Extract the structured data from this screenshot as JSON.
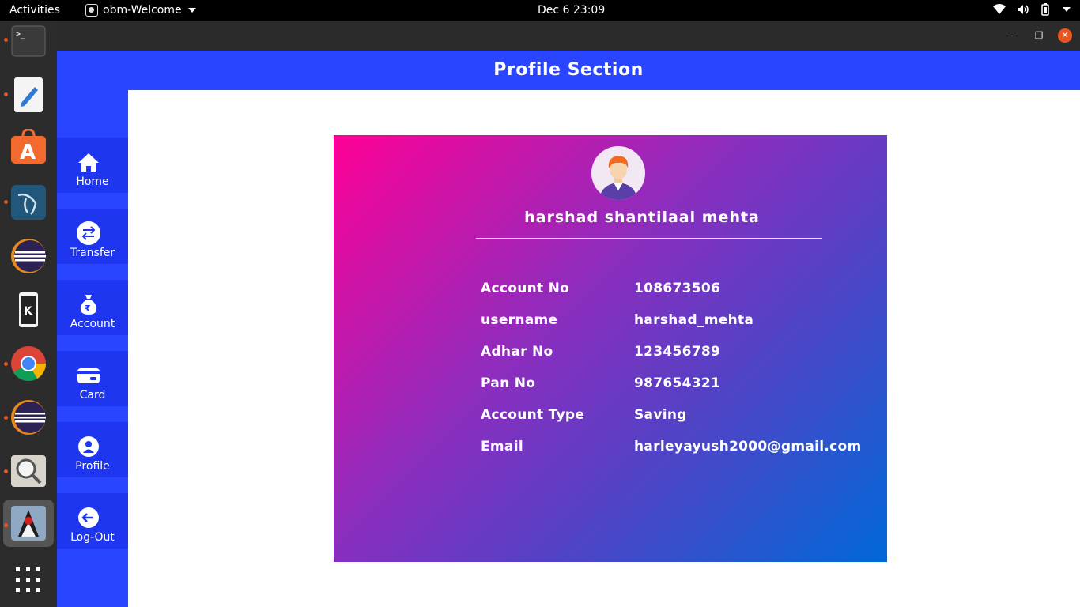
{
  "system": {
    "activities": "Activities",
    "app_name": "obm-Welcome",
    "clock": "Dec 6  23:09"
  },
  "dock": {
    "items": [
      "terminal-icon",
      "text-editor-icon",
      "software-center-icon",
      "mysql-workbench-icon",
      "eclipse-icon",
      "kde-app-icon",
      "chrome-icon",
      "eclipse-icon",
      "image-viewer-icon",
      "java-duke-icon",
      "app-grid-icon"
    ]
  },
  "window": {
    "header_title": "Profile Section"
  },
  "sidebar": {
    "items": [
      {
        "label": "Home",
        "icon": "home-icon"
      },
      {
        "label": "Transfer",
        "icon": "transfer-icon"
      },
      {
        "label": "Account",
        "icon": "money-bag-icon"
      },
      {
        "label": "Card",
        "icon": "card-icon"
      },
      {
        "label": "Profile",
        "icon": "profile-icon"
      },
      {
        "label": "Log-Out",
        "icon": "logout-icon"
      }
    ]
  },
  "profile": {
    "name": "harshad shantilaal mehta",
    "rows": [
      {
        "label": "Account No",
        "value": "108673506"
      },
      {
        "label": "username",
        "value": "harshad_mehta"
      },
      {
        "label": "Adhar No",
        "value": "123456789"
      },
      {
        "label": "Pan No",
        "value": "987654321"
      },
      {
        "label": "Account Type",
        "value": "Saving"
      },
      {
        "label": "Email",
        "value": "harleyayush2000@gmail.com"
      }
    ]
  },
  "colors": {
    "accent": "#2a45ff",
    "card_gradient_start": "#ff0096",
    "card_gradient_end": "#0068d8"
  }
}
